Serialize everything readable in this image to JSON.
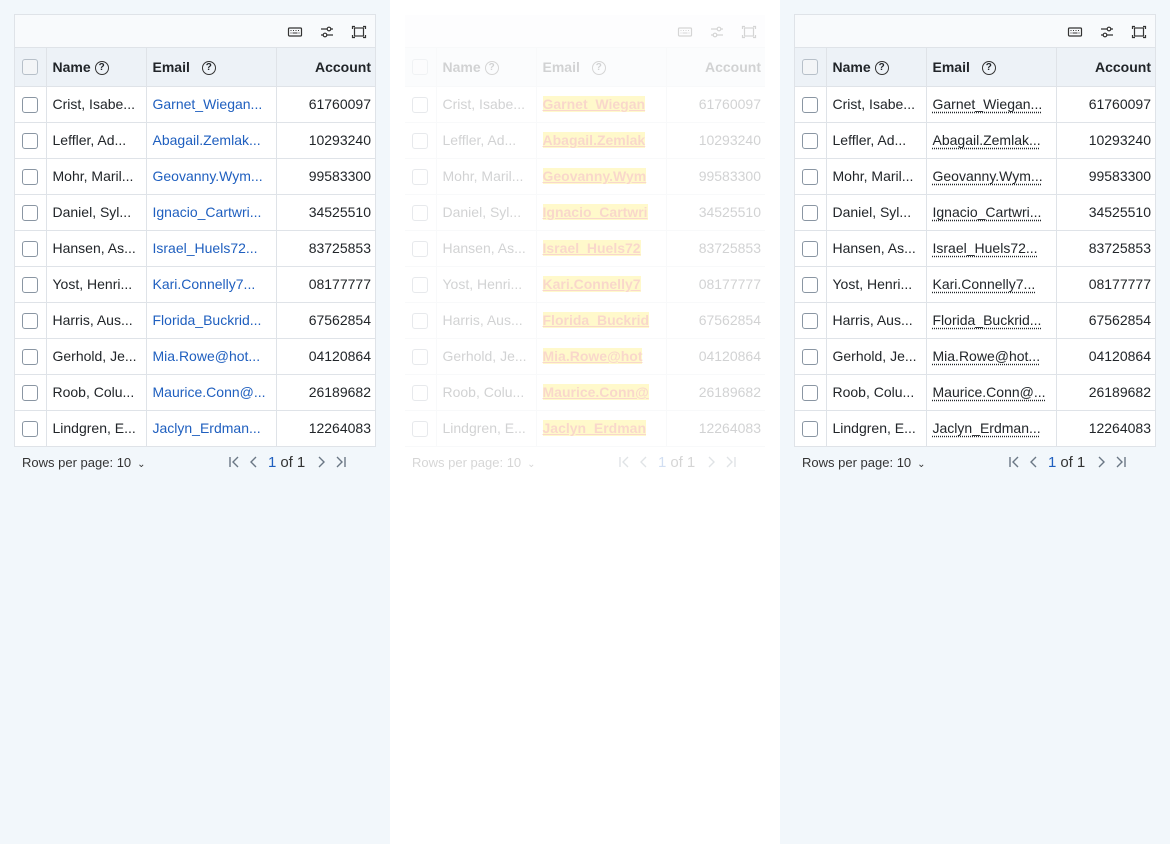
{
  "table": {
    "columns": {
      "name": "Name",
      "email": "Email",
      "account": "Account"
    },
    "rows": [
      {
        "name": "Crist, Isabe...",
        "email": "Garnet_Wiegan...",
        "account": "61760097"
      },
      {
        "name": "Leffler, Ad...",
        "email": "Abagail.Zemlak...",
        "account": "10293240"
      },
      {
        "name": "Mohr, Maril...",
        "email": "Geovanny.Wym...",
        "account": "99583300"
      },
      {
        "name": "Daniel, Syl...",
        "email": "Ignacio_Cartwri...",
        "account": "34525510"
      },
      {
        "name": "Hansen, As...",
        "email": "Israel_Huels72...",
        "account": "83725853"
      },
      {
        "name": "Yost, Henri...",
        "email": "Kari.Connelly7...",
        "account": "08177777"
      },
      {
        "name": "Harris, Aus...",
        "email": "Florida_Buckrid...",
        "account": "67562854"
      },
      {
        "name": "Gerhold, Je...",
        "email": "Mia.Rowe@hot...",
        "account": "04120864"
      },
      {
        "name": "Roob, Colu...",
        "email": "Maurice.Conn@...",
        "account": "26189682"
      },
      {
        "name": "Lindgren, E...",
        "email": "Jaclyn_Erdman...",
        "account": "12264083"
      }
    ],
    "rows_highlight": [
      "Garnet_Wiegan",
      "Abagail.Zemlak",
      "Geovanny.Wym",
      "Ignacio_Cartwri",
      "Israel_Huels72",
      "Kari.Connelly7",
      "Florida_Buckrid",
      "Mia.Rowe@hot",
      "Maurice.Conn@",
      "Jaclyn_Erdman"
    ]
  },
  "pagination": {
    "rows_per_page_label": "Rows per page:",
    "rows_per_page_value": "10",
    "current_page": "1",
    "of_label": "of",
    "total_pages": "1"
  },
  "icons": {
    "toolbar": [
      "keyboard-icon",
      "filter-settings-icon",
      "fullscreen-icon"
    ],
    "pagination": [
      "first-page-icon",
      "prev-page-icon",
      "next-page-icon",
      "last-page-icon"
    ]
  },
  "colors": {
    "link_blue": "#1f5fbf",
    "highlight_yellow": "#ffe600",
    "highlight_text": "#e53e00",
    "header_bg": "#edf2f7",
    "page_bg": "#f2f7fb"
  }
}
